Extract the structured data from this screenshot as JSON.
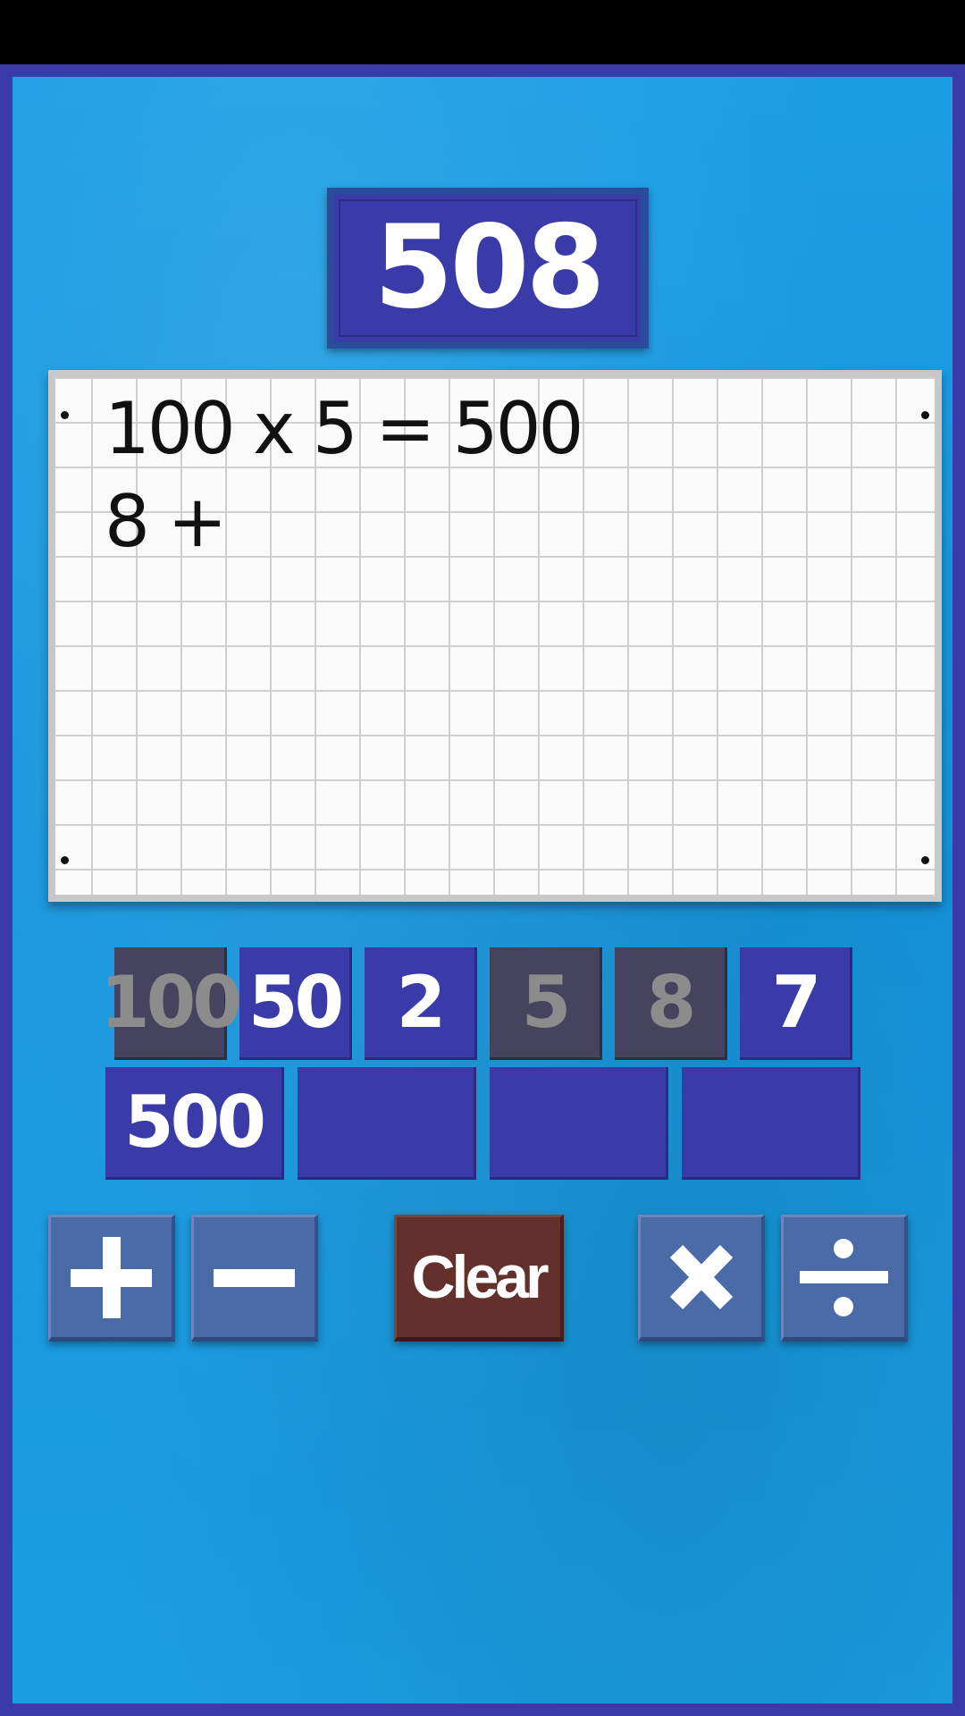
{
  "target": {
    "value": "508"
  },
  "workpad": {
    "lines": [
      "100 x 5 = 500",
      "8 +"
    ]
  },
  "numbers": [
    {
      "value": "100",
      "used": true
    },
    {
      "value": "50",
      "used": false
    },
    {
      "value": "2",
      "used": false
    },
    {
      "value": "5",
      "used": true
    },
    {
      "value": "8",
      "used": true
    },
    {
      "value": "7",
      "used": false
    }
  ],
  "results": [
    {
      "value": "500"
    },
    {
      "value": ""
    },
    {
      "value": ""
    },
    {
      "value": ""
    }
  ],
  "operators": {
    "add_icon": "plus-icon",
    "subtract_icon": "minus-icon",
    "multiply_icon": "multiply-icon",
    "divide_icon": "divide-icon"
  },
  "clear": {
    "label": "Clear"
  },
  "colors": {
    "frame": "#3a3aa8",
    "background": "#1a9ee4",
    "tile": "#3a3aa8",
    "tile_used": "#45435e",
    "operator": "#4a6aa8",
    "clear": "#63302c"
  }
}
